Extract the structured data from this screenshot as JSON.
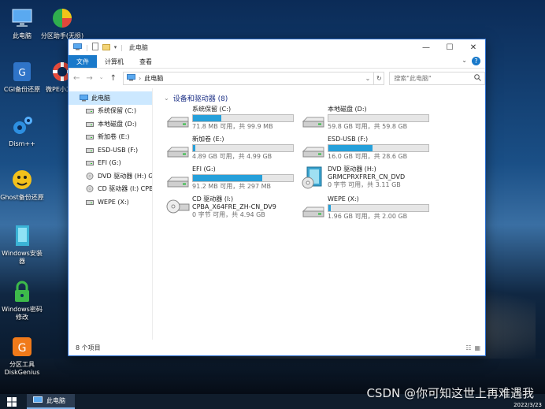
{
  "desktop": {
    "icons": [
      {
        "label": "此电脑",
        "icon": "computer-icon"
      },
      {
        "label": "分区助手(无损)",
        "icon": "partition-assistant-icon"
      },
      {
        "label": "CGI备份还原",
        "icon": "cgi-backup-icon"
      },
      {
        "label": "微PE小工具",
        "icon": "lifebuoy-icon"
      },
      {
        "label": "Dism++",
        "icon": "gears-icon"
      },
      {
        "label": "Ghost备份还原",
        "icon": "ghost-icon"
      },
      {
        "label": "Windows安装器",
        "icon": "windows-installer-icon"
      },
      {
        "label": "Windows密码修改",
        "icon": "padlock-icon"
      },
      {
        "label": "分区工具DiskGenius",
        "icon": "diskgenius-icon"
      }
    ]
  },
  "window": {
    "title": "此电脑",
    "ribbon_tabs": [
      "文件",
      "计算机",
      "查看"
    ],
    "breadcrumb": "此电脑",
    "search_placeholder": "搜索\"此电脑\"",
    "status": "8 个项目"
  },
  "sidebar": {
    "items": [
      {
        "label": "此电脑",
        "icon": "computer-icon",
        "selected": true
      },
      {
        "label": "系统保留 (C:)",
        "icon": "drive-icon"
      },
      {
        "label": "本地磁盘 (D:)",
        "icon": "drive-icon"
      },
      {
        "label": "新加卷 (E:)",
        "icon": "drive-icon"
      },
      {
        "label": "ESD-USB (F:)",
        "icon": "drive-icon"
      },
      {
        "label": "EFI (G:)",
        "icon": "drive-icon"
      },
      {
        "label": "DVD 驱动器 (H:) G",
        "icon": "dvd-icon"
      },
      {
        "label": "CD 驱动器 (I:) CPB",
        "icon": "cd-icon"
      },
      {
        "label": "WEPE (X:)",
        "icon": "drive-icon"
      }
    ]
  },
  "main": {
    "group_title": "设备和驱动器 (8)",
    "drives": [
      {
        "name": "系统保留 (C:)",
        "capacity": "71.8 MB 可用，共 99.9 MB",
        "used_fraction": 0.28,
        "kind": "hdd"
      },
      {
        "name": "本地磁盘 (D:)",
        "capacity": "59.8 GB 可用，共 59.8 GB",
        "used_fraction": 0.0,
        "kind": "hdd"
      },
      {
        "name": "新加卷 (E:)",
        "capacity": "4.89 GB 可用，共 4.99 GB",
        "used_fraction": 0.02,
        "kind": "hdd"
      },
      {
        "name": "ESD-USB (F:)",
        "capacity": "16.0 GB 可用，共 28.6 GB",
        "used_fraction": 0.44,
        "kind": "hdd"
      },
      {
        "name": "EFI (G:)",
        "capacity": "91.2 MB 可用，共 297 MB",
        "used_fraction": 0.69,
        "kind": "hdd"
      },
      {
        "name": "DVD 驱动器 (H:)",
        "subtitle": "GRMCPRXFRER_CN_DVD",
        "capacity": "0 字节 可用，共 3.11 GB",
        "kind": "dvd"
      },
      {
        "name": "CD 驱动器 (I:)",
        "subtitle": "CPBA_X64FRE_ZH-CN_DV9",
        "capacity": "0 字节 可用，共 4.94 GB",
        "kind": "cd"
      },
      {
        "name": "WEPE (X:)",
        "capacity": "1.96 GB 可用，共 2.00 GB",
        "used_fraction": 0.02,
        "kind": "hdd"
      }
    ]
  },
  "taskbar": {
    "task_label": "此电脑",
    "date": "2022/3/23"
  },
  "watermark": "CSDN @你可知这世上再难遇我",
  "colors": {
    "accent": "#1979ca",
    "bar_fill": "#26a0da",
    "selection": "#cce8ff"
  }
}
